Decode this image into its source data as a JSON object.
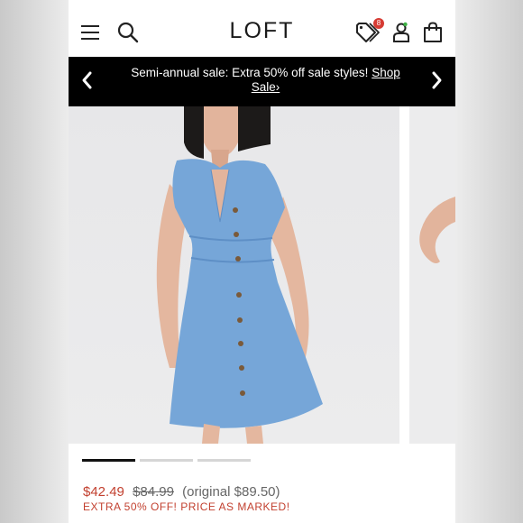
{
  "header": {
    "logo": "LOFT",
    "wishlist_count": "8"
  },
  "promo": {
    "message": "Semi-annual sale: Extra 50% off sale styles!",
    "link": "Shop Sale›"
  },
  "gallery": {
    "active_index": 0,
    "count": 3
  },
  "product": {
    "sale_price": "$42.49",
    "old_price": "$84.99",
    "original_price": "(original $89.50)",
    "promo_note": "EXTRA 50% OFF! PRICE AS MARKED!"
  },
  "colors": {
    "accent": "#c2402f",
    "banner": "#000000",
    "badge": "#d63b33"
  }
}
